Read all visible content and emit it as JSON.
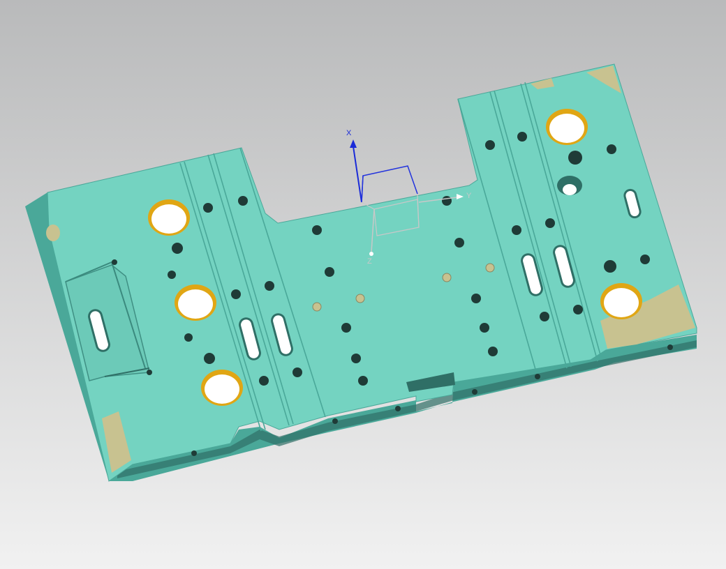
{
  "viewport": {
    "background_top": "#b9babb",
    "background_bottom": "#f1f1f1"
  },
  "model": {
    "part": "mold-plate",
    "face_color": "#74d3c1",
    "side_color": "#4aa899",
    "dark_edge_color": "#2f6f66",
    "machined_color": "#c8c290",
    "bushing_color": "#e0a614"
  },
  "triad": {
    "x_label": "X",
    "y_label": "Y",
    "z_label": "Z",
    "x_color": "#1a2bd8",
    "box_color": "#2233dd",
    "y_color": "#c8c8c8"
  }
}
